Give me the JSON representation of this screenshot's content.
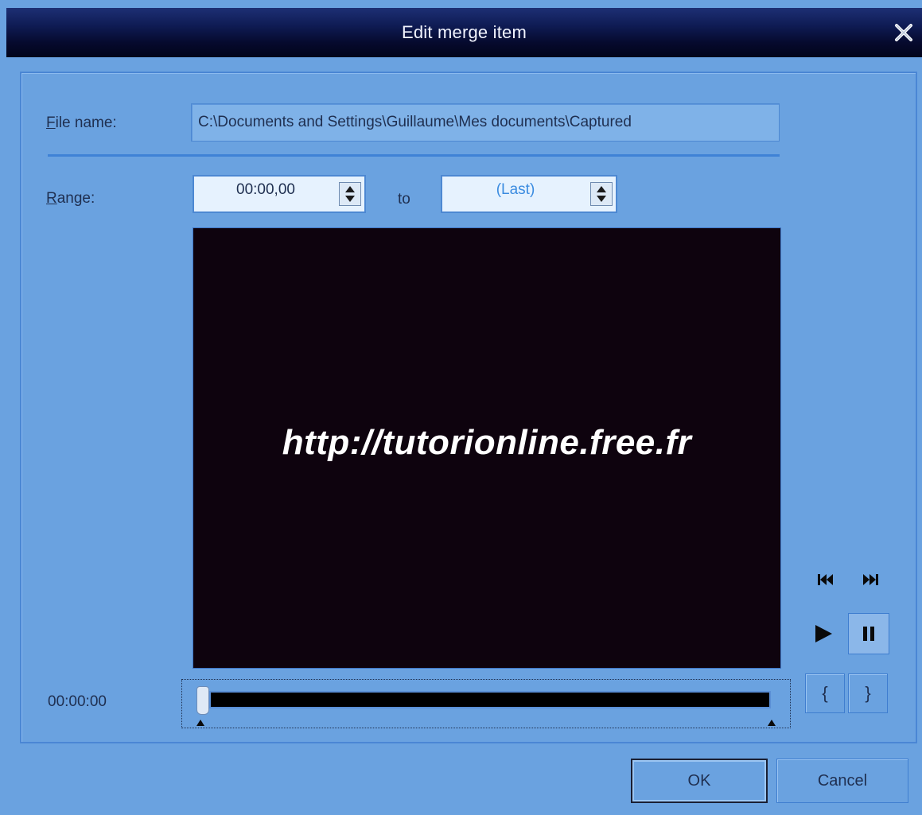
{
  "window": {
    "title": "Edit merge item"
  },
  "file": {
    "label_hotkey": "F",
    "label_rest": "ile name:",
    "value": "C:\\Documents and Settings\\Guillaume\\Mes documents\\Captured"
  },
  "range": {
    "label_hotkey": "R",
    "label_rest": "ange:",
    "start": "00:00,00",
    "to_label": "to",
    "end": "(Last)"
  },
  "video": {
    "overlay_text": "http://tutorionline.free.fr"
  },
  "playback": {
    "time": "00:00:00",
    "position": 0,
    "mark_in_label": "{",
    "mark_out_label": "}"
  },
  "buttons": {
    "ok": "OK",
    "cancel": "Cancel"
  },
  "colors": {
    "dialog_bg": "#6aa2e0",
    "titlebar": "#0f1c55",
    "video_bg": "#0e030e",
    "end_value_text": "#3a8be0"
  },
  "icons": [
    "close-icon",
    "skip-back-icon",
    "skip-forward-icon",
    "play-icon",
    "pause-icon",
    "spin-up-down-icon"
  ]
}
